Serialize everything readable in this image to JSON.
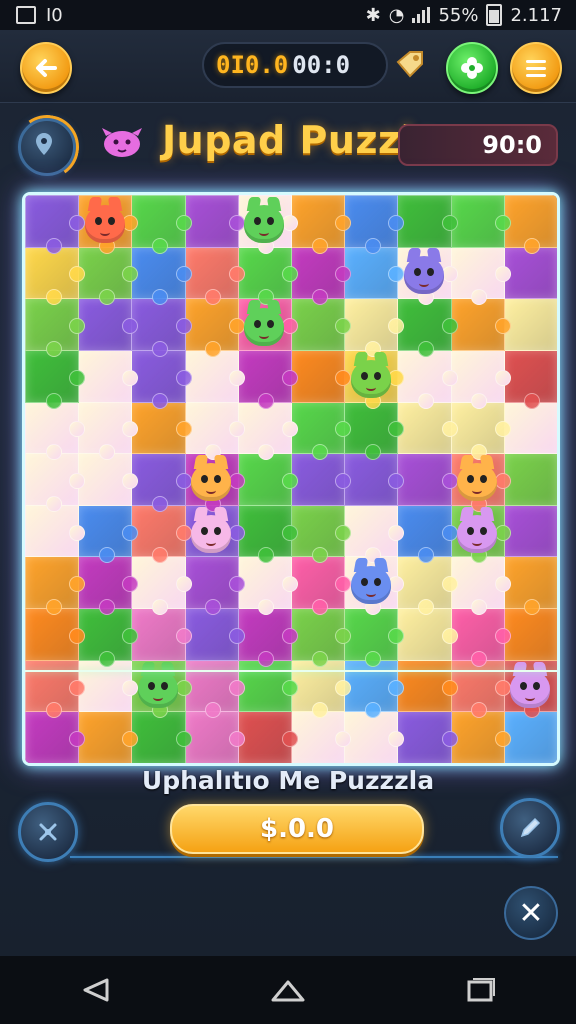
{
  "status_bar": {
    "left_text": "I0",
    "battery_percent": "55%",
    "time": "2.117"
  },
  "top_bar": {
    "timer_gold": "0I0.0",
    "timer_white": "00:0",
    "back_icon": "arrow-left-icon",
    "tag_icon": "price-tag-icon",
    "hint_icon": "clover-icon",
    "menu_icon": "hamburger-menu-icon"
  },
  "header": {
    "title": "Jupad Puzzle",
    "score": "90:0",
    "compass_icon": "compass-icon",
    "mascot_icon": "pink-creature-icon"
  },
  "board": {
    "rows": 11,
    "cols": 10,
    "palette": [
      "#3fbf3a",
      "#57d84a",
      "#ff8a1e",
      "#ffa32a",
      "#ff5fa8",
      "#f07ac8",
      "#a84fd8",
      "#8a5be0",
      "#4a8cf0",
      "#5ab0ff",
      "#ffd84a",
      "#fff0a0",
      "#ff7a6a",
      "#e05050",
      "#c43ac0",
      "#7ad24a"
    ]
  },
  "footer": {
    "subtitle": "Uphalıtıo Me Puzzzla",
    "price": "$.0.0",
    "left_icon": "tools-icon",
    "right_icon": "pencil-icon",
    "close_label": "✕"
  },
  "colors": {
    "accent_gold": "#ffcf4a",
    "board_glow": "#7ff1ff",
    "button_orange": "#f29a12",
    "button_green": "#1fae2a"
  }
}
